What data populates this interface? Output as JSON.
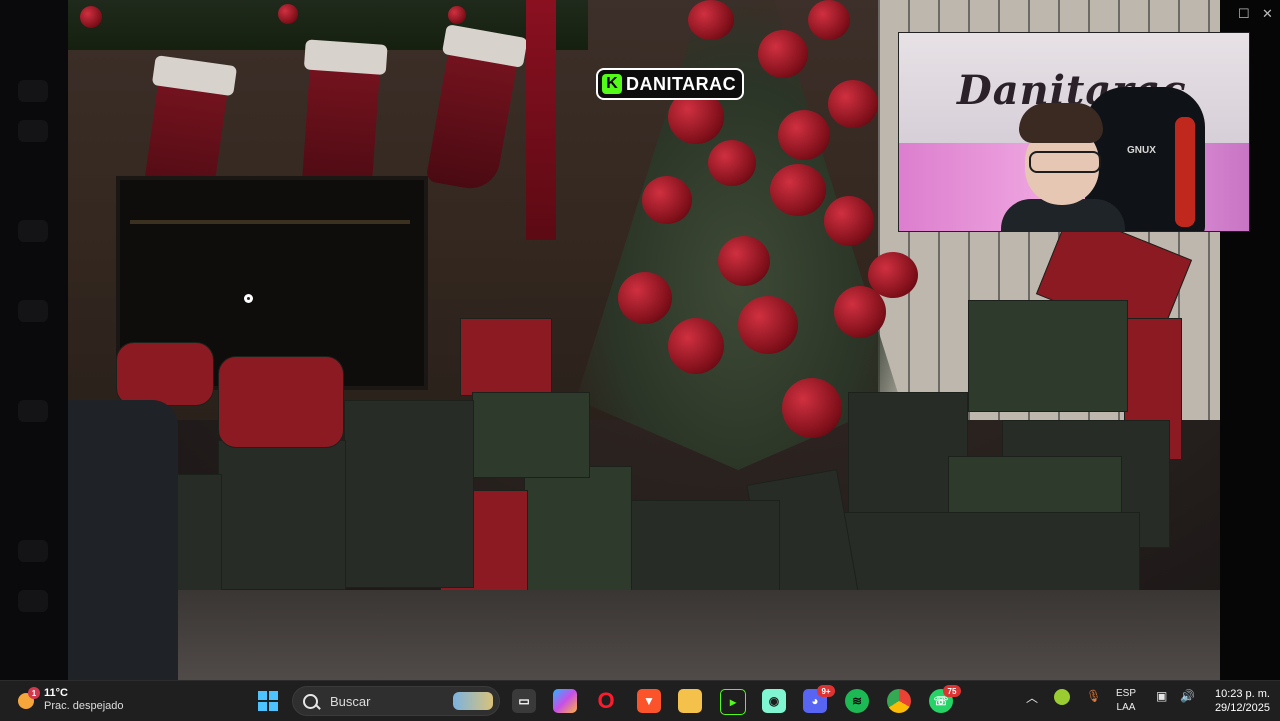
{
  "stream": {
    "streamer_tag": "DANITARAC",
    "platform_icon_letter": "K",
    "webcam": {
      "wall_tag": "Danitarac",
      "chair_brand": "GNUX"
    }
  },
  "taskbar": {
    "weather": {
      "temperature": "11°C",
      "condition": "Prac. despejado",
      "badge": "1"
    },
    "search_label": "Buscar",
    "apps": [
      {
        "name": "task-view",
        "icon": "task-view-icon"
      },
      {
        "name": "copilot",
        "icon": "copilot-icon"
      },
      {
        "name": "opera",
        "icon": "opera-icon"
      },
      {
        "name": "brave",
        "icon": "brave-icon"
      },
      {
        "name": "file-explorer",
        "icon": "folder-icon"
      },
      {
        "name": "kick-studio",
        "icon": "kick-icon"
      },
      {
        "name": "streamlabs",
        "icon": "streamlabs-icon"
      },
      {
        "name": "discord",
        "icon": "discord-icon",
        "badge": "9+"
      },
      {
        "name": "spotify",
        "icon": "spotify-icon"
      },
      {
        "name": "chrome",
        "icon": "chrome-icon"
      },
      {
        "name": "whatsapp",
        "icon": "whatsapp-icon",
        "badge": "75"
      }
    ],
    "language": {
      "line1": "ESP",
      "line2": "LAA"
    },
    "clock": {
      "time": "10:23 p. m.",
      "date": "29/12/2025"
    }
  },
  "colors": {
    "taskbar_bg": "#1f1f1f",
    "kick_green": "#53fc18",
    "win_blue": "#4cc2ff"
  }
}
